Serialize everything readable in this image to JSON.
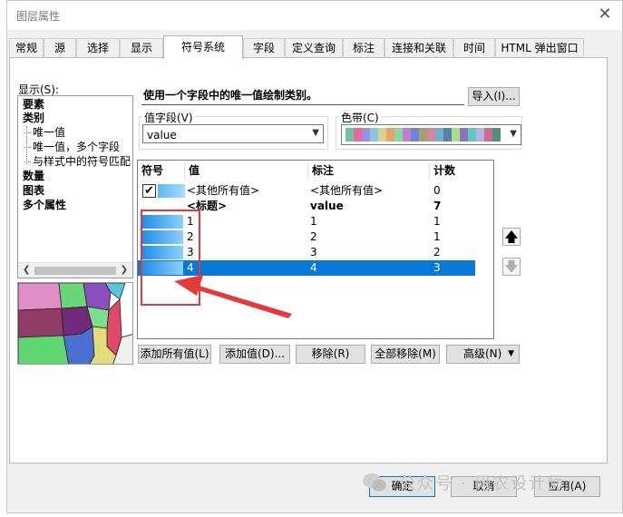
{
  "window": {
    "title": "图层属性"
  },
  "tabs": [
    {
      "label": "常规",
      "active": false
    },
    {
      "label": "源",
      "active": false
    },
    {
      "label": "选择",
      "active": false
    },
    {
      "label": "显示",
      "active": false
    },
    {
      "label": "符号系统",
      "active": true
    },
    {
      "label": "字段",
      "active": false
    },
    {
      "label": "定义查询",
      "active": false
    },
    {
      "label": "标注",
      "active": false
    },
    {
      "label": "连接和关联",
      "active": false
    },
    {
      "label": "时间",
      "active": false
    },
    {
      "label": "HTML 弹出窗口",
      "active": false
    }
  ],
  "show_panel": {
    "label": "显示(S):",
    "items": [
      {
        "label": "要素",
        "level": 0
      },
      {
        "label": "类别",
        "level": 0
      },
      {
        "label": "唯一值",
        "level": 1
      },
      {
        "label": "唯一值，多个字段",
        "level": 1
      },
      {
        "label": "与样式中的符号匹配",
        "level": 1
      },
      {
        "label": "数量",
        "level": 0
      },
      {
        "label": "图表",
        "level": 0
      },
      {
        "label": "多个属性",
        "level": 0
      }
    ]
  },
  "description": "使用一个字段中的唯一值绘制类别。",
  "import_button": "导入(I)...",
  "value_field": {
    "label": "值字段(V)",
    "value": "value"
  },
  "color_ramp": {
    "label": "色带(C)",
    "colors": [
      "#6fc3a0",
      "#e26d9b",
      "#9d8fe0",
      "#86c9e3",
      "#d6d38a",
      "#e6a26b",
      "#8ad6a6",
      "#c77bc9",
      "#6b86d6",
      "#9fa36a",
      "#d6879d",
      "#70b3c6",
      "#5d7fb0",
      "#a7e085",
      "#8f72c3",
      "#5fc9bb",
      "#b0b7e8",
      "#cc6f83",
      "#4f8f86"
    ]
  },
  "table": {
    "headers": [
      "符号",
      "值",
      "标注",
      "计数"
    ],
    "rows": [
      {
        "value": "<其他所有值>",
        "label": "<其他所有值>",
        "count": "0",
        "type": "other",
        "checked": true
      },
      {
        "value": "<标题>",
        "label": "value",
        "count": "7",
        "type": "heading"
      },
      {
        "value": "1",
        "label": "1",
        "count": "1",
        "type": "item"
      },
      {
        "value": "2",
        "label": "2",
        "count": "1",
        "type": "item"
      },
      {
        "value": "3",
        "label": "3",
        "count": "2",
        "type": "item"
      },
      {
        "value": "4",
        "label": "4",
        "count": "3",
        "type": "item",
        "selected": true
      }
    ]
  },
  "buttons": {
    "add_all": "添加所有值(L)",
    "add_values": "添加值(D)...",
    "remove": "移除(R)",
    "remove_all": "全部移除(M)",
    "advanced": "高级(N)",
    "ok": "确定",
    "cancel": "取消",
    "apply": "应用(A)"
  },
  "watermark": "公众号 · 码农设计师",
  "accent_colors": {
    "selection": "#0a78d7",
    "annotation": "#e53a3a"
  }
}
